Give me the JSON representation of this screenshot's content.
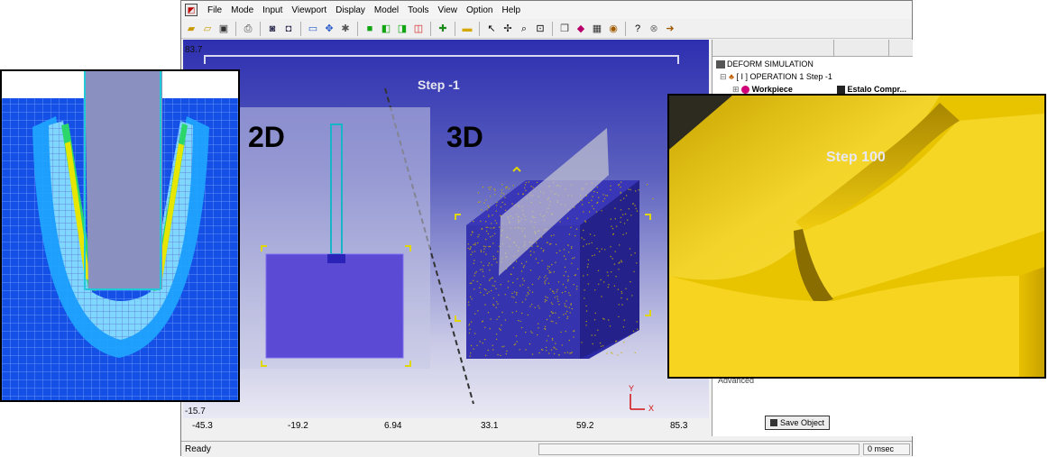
{
  "menu": [
    "File",
    "Mode",
    "Input",
    "Viewport",
    "Display",
    "Model",
    "Tools",
    "View",
    "Option",
    "Help"
  ],
  "toolbar_icons": [
    "open-folder-icon",
    "open-file-icon",
    "save-icon",
    "print-icon",
    "camera-icon",
    "snapshot-icon",
    "window-icon",
    "move-icon",
    "bug-icon",
    "green-cube-icon",
    "green-cubes-icon",
    "copy-cube-icon",
    "red-cube-icon",
    "add-object-icon",
    "ruler-icon",
    "pointer-icon",
    "pan-icon",
    "zoom-icon",
    "zoom-box-icon",
    "cubes-icon",
    "color-icon",
    "grid-icon",
    "object-icon",
    "help-pointer-icon",
    "stop-icon",
    "exit-icon"
  ],
  "viewport": {
    "y_top": "83.7",
    "y_bottom": "-15.7",
    "step_label": "Step   -1",
    "label_2d": "2D",
    "label_3d": "3D",
    "axis_y": "Y",
    "axis_x": "X",
    "x_ticks": [
      "-45.3",
      "-19.2",
      "6.94",
      "33.1",
      "59.2",
      "85.3"
    ]
  },
  "tree": {
    "root": "DEFORM SIMULATION",
    "operation": "[ I ] OPERATION 1  Step -1",
    "workpiece": "Workpiece",
    "workpiece_state": "Estalo Compr...",
    "advanced": "Advanced",
    "save_button": "Save Object"
  },
  "status": {
    "left": "Ready",
    "right": "0 msec"
  },
  "inset_3d": {
    "step_label": "Step  100"
  }
}
